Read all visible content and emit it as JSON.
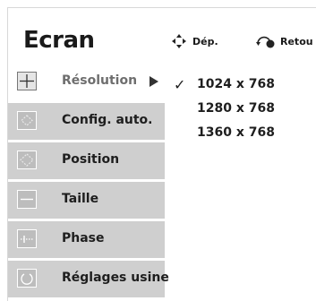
{
  "header": {
    "title": "Ecran",
    "hint_move": "Dép.",
    "hint_back": "Retou"
  },
  "menu": {
    "items": [
      {
        "label": "Résolution",
        "icon": "crosshair-icon",
        "active": true
      },
      {
        "label": "Config. auto.",
        "icon": "auto-config-icon",
        "active": false
      },
      {
        "label": "Position",
        "icon": "position-icon",
        "active": false
      },
      {
        "label": "Taille",
        "icon": "size-icon",
        "active": false
      },
      {
        "label": "Phase",
        "icon": "phase-icon",
        "active": false
      },
      {
        "label": "Réglages usine",
        "icon": "reset-icon",
        "active": false
      }
    ]
  },
  "resolution": {
    "selected": "1024 x 768",
    "check_glyph": "✓",
    "options": [
      "1024 x 768",
      "1280 x 768",
      "1360 x 768"
    ]
  },
  "colors": {
    "item_bg": "#cfcfcf",
    "active_bg": "#ffffff",
    "text": "#1e1e1e"
  }
}
